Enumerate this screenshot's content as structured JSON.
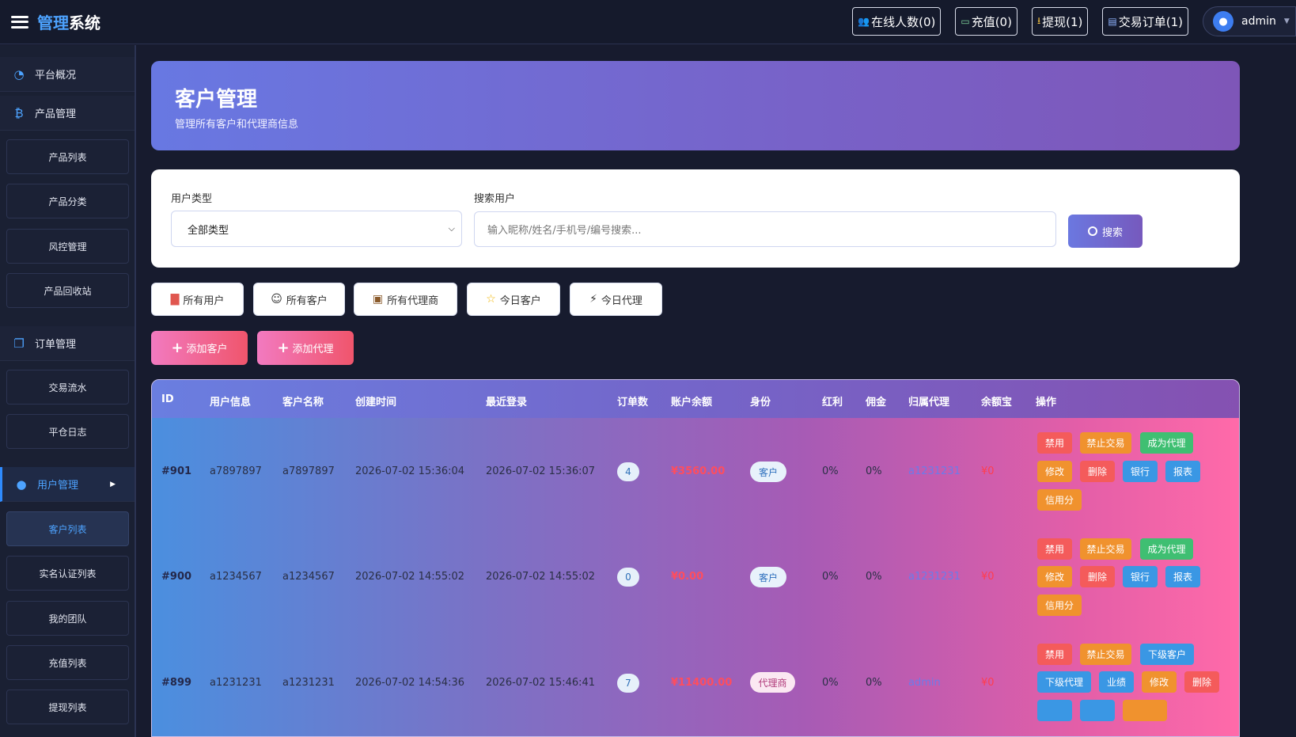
{
  "brand": {
    "part1": "管理",
    "part2": "系统"
  },
  "topbar": {
    "online": "在线人数(0)",
    "recharge": "充值(0)",
    "withdraw": "提现(1)",
    "orders": "交易订单(1)",
    "admin": "admin"
  },
  "sidebar": {
    "overview": "平台概况",
    "product_mgmt": "产品管理",
    "product_list": "产品列表",
    "product_category": "产品分类",
    "risk_mgmt": "风控管理",
    "product_recycle": "产品回收站",
    "order_mgmt": "订单管理",
    "trade_flow": "交易流水",
    "close_log": "平仓日志",
    "user_mgmt": "用户管理",
    "customer_list": "客户列表",
    "realname_list": "实名认证列表",
    "my_team": "我的团队",
    "recharge_list": "充值列表",
    "withdraw_list": "提现列表"
  },
  "hero": {
    "title": "客户管理",
    "subtitle": "管理所有客户和代理商信息"
  },
  "filter": {
    "type_label": "用户类型",
    "type_value": "全部类型",
    "search_label": "搜索用户",
    "search_placeholder": "输入昵称/姓名/手机号/编号搜索...",
    "search_button": "搜索"
  },
  "quick": {
    "all_users": "所有用户",
    "all_customers": "所有客户",
    "all_agents": "所有代理商",
    "today_customers": "今日客户",
    "today_agents": "今日代理"
  },
  "actions": {
    "add_customer": "添加客户",
    "add_agent": "添加代理"
  },
  "table": {
    "headers": {
      "id": "ID",
      "user_info": "用户信息",
      "customer_name": "客户名称",
      "created": "创建时间",
      "last_login": "最近登录",
      "orders": "订单数",
      "balance": "账户余额",
      "role": "身份",
      "bonus": "红利",
      "commission": "佣金",
      "agent": "归属代理",
      "yuebao": "余额宝",
      "ops": "操作"
    },
    "rows": [
      {
        "id": "#901",
        "user": "a7897897",
        "name": "a7897897",
        "created": "2026-07-02 15:36:04",
        "login": "2026-07-02 15:36:07",
        "orders": "4",
        "balance": "¥3560.00",
        "role": "客户",
        "bonus": "0%",
        "commission": "0%",
        "agent": "a1231231",
        "yuebao": "¥0",
        "ops": [
          "禁用",
          "禁止交易",
          "成为代理",
          "修改",
          "删除",
          "银行",
          "报表",
          "信用分"
        ]
      },
      {
        "id": "#900",
        "user": "a1234567",
        "name": "a1234567",
        "created": "2026-07-02 14:55:02",
        "login": "2026-07-02 14:55:02",
        "orders": "0",
        "balance": "¥0.00",
        "role": "客户",
        "bonus": "0%",
        "commission": "0%",
        "agent": "a1231231",
        "yuebao": "¥0",
        "ops": [
          "禁用",
          "禁止交易",
          "成为代理",
          "修改",
          "删除",
          "银行",
          "报表",
          "信用分"
        ]
      },
      {
        "id": "#899",
        "user": "a1231231",
        "name": "a1231231",
        "created": "2026-07-02 14:54:36",
        "login": "2026-07-02 15:46:41",
        "orders": "7",
        "balance": "¥11400.00",
        "role": "代理商",
        "bonus": "0%",
        "commission": "0%",
        "agent": "admin",
        "yuebao": "¥0",
        "ops": [
          "禁用",
          "禁止交易",
          "下级客户",
          "下级代理",
          "业绩",
          "修改",
          "删除"
        ]
      }
    ]
  },
  "colors": {
    "accent": "#4da3ff",
    "danger": "#f45b5b",
    "warning": "#f0922e",
    "success": "#3fbf72",
    "info": "#3a97e4"
  }
}
